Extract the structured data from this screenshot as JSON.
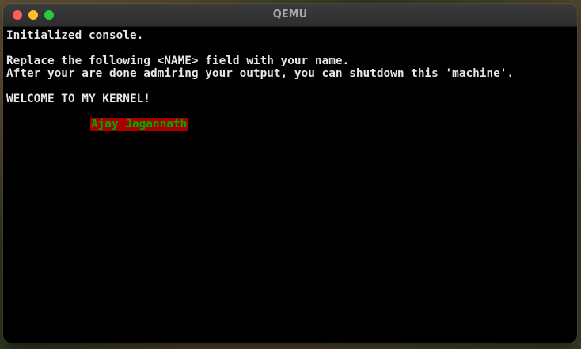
{
  "window": {
    "title": "QEMU"
  },
  "console": {
    "lines": [
      "Initialized console.",
      "",
      "Replace the following <NAME> field with your name.",
      "After your are done admiring your output, you can shutdown this 'machine'.",
      "",
      "WELCOME TO MY KERNEL!"
    ],
    "name": "Ajay Jagannath"
  },
  "colors": {
    "name_background": "#a80000",
    "name_foreground": "#00a800",
    "console_background": "#000000",
    "console_text": "#e6e6e6"
  }
}
